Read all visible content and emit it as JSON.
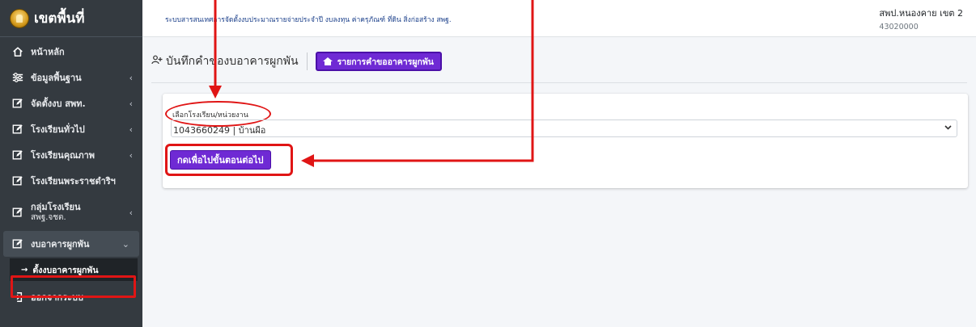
{
  "brand": {
    "title": "เขตพื้นที่"
  },
  "sidebar": {
    "items": [
      {
        "label": "หน้าหลัก",
        "icon": "home-icon",
        "chevron": ""
      },
      {
        "label": "ข้อมูลพื้นฐาน",
        "icon": "sliders-icon",
        "chevron": "‹"
      },
      {
        "label": "จัดตั้งงบ สพท.",
        "icon": "edit-icon",
        "chevron": "‹"
      },
      {
        "label": "โรงเรียนทั่วไป",
        "icon": "edit-icon",
        "chevron": "‹"
      },
      {
        "label": "โรงเรียนคุณภาพ",
        "icon": "edit-icon",
        "chevron": "‹"
      },
      {
        "label": "โรงเรียนพระราชดำริฯ",
        "icon": "edit-icon",
        "chevron": ""
      },
      {
        "label_line1": "กลุ่มโรงเรียน",
        "label_line2": "สพฐ.จชต.",
        "icon": "edit-icon",
        "chevron": "‹"
      },
      {
        "label": "งบอาคารผูกพัน",
        "icon": "edit-icon",
        "chevron": "⌄"
      }
    ],
    "sub_item": {
      "label": "ตั้งงบอาคารผูกพัน",
      "icon": "arrow-right-icon"
    },
    "logout": {
      "label": "ออกจากระบบ",
      "icon": "logout-icon"
    }
  },
  "topbar": {
    "title": "ระบบสารสนเทศการจัดตั้งงบประมาณรายจ่ายประจำปี งบลงทุน ค่าครุภัณฑ์ ที่ดิน สิ่งก่อสร้าง สพฐ.",
    "org_name": "สพป.หนองคาย เขต 2",
    "org_code": "43020000"
  },
  "page": {
    "title": "บันทึกคำของบอาคารผูกพัน",
    "list_button": "รายการคำขออาคารผูกพัน"
  },
  "form": {
    "school_label": "เลือกโรงเรียน/หน่วยงาน",
    "school_value": "1043660249 | บ้านผือ",
    "next_button": "กดเพื่อไปขั้นตอนต่อไป"
  },
  "colors": {
    "accent": "#6f2ad4",
    "annotation": "#e01515",
    "sidebar": "#343a40"
  }
}
